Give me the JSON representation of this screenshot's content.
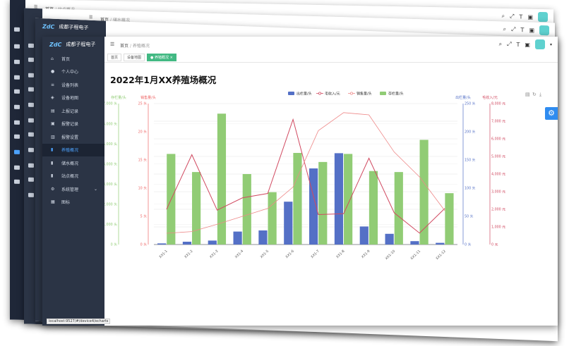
{
  "app": {
    "logo_mark": "ZdC",
    "logo_text": "成都子程电子"
  },
  "windows_behind": [
    {
      "breadcrumb_home": "首页",
      "breadcrumb_current": "站点概况"
    },
    {
      "breadcrumb_home": "首页",
      "breadcrumb_current": "储水概况"
    }
  ],
  "breadcrumb": {
    "home": "首页",
    "current": "养殖概况"
  },
  "tabs": [
    {
      "label": "首页"
    },
    {
      "label": "设备地图"
    },
    {
      "label": "养殖概况"
    }
  ],
  "sidebar": {
    "items": [
      {
        "label": "首页",
        "icon": "home-icon"
      },
      {
        "label": "个人中心",
        "icon": "user-icon"
      },
      {
        "label": "设备列表",
        "icon": "list-icon"
      },
      {
        "label": "设备地图",
        "icon": "map-icon"
      },
      {
        "label": "上报记录",
        "icon": "upload-icon"
      },
      {
        "label": "报警记录",
        "icon": "alarm-icon"
      },
      {
        "label": "报警设置",
        "icon": "settings-icon"
      },
      {
        "label": "养殖概况",
        "icon": "bar-chart-icon",
        "active": true
      },
      {
        "label": "储水概况",
        "icon": "bar-chart-icon"
      },
      {
        "label": "站点概况",
        "icon": "bar-chart-icon"
      },
      {
        "label": "系统管理",
        "icon": "gear-icon"
      },
      {
        "label": "图标",
        "icon": "icons-icon"
      }
    ]
  },
  "page_title": "2022年1月XX养殖场概况",
  "status_url": "localhost:9527/#/device4/echarts",
  "colors": {
    "sidebar": "#2b3445",
    "accent": "#4da3ff",
    "tab_active": "#42b983",
    "gear_button": "#2f8cf0"
  },
  "chart_data": {
    "type": "bar",
    "legend": [
      "出栏量/头",
      "毛收入/元",
      "销售量/头",
      "存栏量/头"
    ],
    "legend_position": "top-center",
    "categories": [
      "XX1-1",
      "XX1-2",
      "XX1-3",
      "XX1-4",
      "XX1-5",
      "XX1-6",
      "XX1-7",
      "XX1-8",
      "XX1-9",
      "XX1-10",
      "XX1-11",
      "XX1-12"
    ],
    "axes": [
      {
        "label": "存栏量/头",
        "position": "left-outer",
        "color": "#91cc75",
        "min": 0,
        "max": 7000,
        "ticks": [
          "0 头",
          "1,000 头",
          "2,000 头",
          "3,000 头",
          "4,000 头",
          "5,000 头",
          "6,000 头",
          "7,000 头"
        ]
      },
      {
        "label": "销售量/头",
        "position": "left-inner",
        "color": "#ee6666",
        "min": 0,
        "max": 25,
        "ticks": [
          "0 头",
          "5 头",
          "10 头",
          "15 头",
          "20 头",
          "25 头"
        ]
      },
      {
        "label": "出栏量/头",
        "position": "right-inner",
        "color": "#5470c6",
        "min": 0,
        "max": 250,
        "ticks": [
          "0 头",
          "50 头",
          "100 头",
          "150 头",
          "200 头",
          "250 头"
        ]
      },
      {
        "label": "毛收入/元",
        "position": "right-outer",
        "color": "#d14a61",
        "min": 0,
        "max": 8000,
        "ticks": [
          "0 元",
          "1,000 元",
          "2,000 元",
          "3,000 元",
          "4,000 元",
          "5,000 元",
          "6,000 元",
          "7,000 元",
          "8,000 元"
        ]
      }
    ],
    "series": [
      {
        "name": "出栏量/头",
        "type": "bar",
        "axis": 2,
        "color": "#5470c6",
        "values": [
          2,
          5,
          7,
          23,
          25,
          76,
          135,
          162,
          32,
          19,
          6,
          3
        ]
      },
      {
        "name": "存栏量/头",
        "type": "bar",
        "axis": 0,
        "color": "#91cc75",
        "values": [
          4500,
          3600,
          6500,
          3500,
          2600,
          4550,
          4100,
          4500,
          3650,
          3600,
          5200,
          2550
        ]
      },
      {
        "name": "毛收入/元",
        "type": "line",
        "axis": 3,
        "color": "#d14a61",
        "values": [
          2000,
          5100,
          1950,
          2650,
          2900,
          7100,
          1700,
          1750,
          4900,
          1800,
          650,
          2050
        ]
      },
      {
        "name": "销售量/头",
        "type": "line",
        "axis": 1,
        "color": "#ee8888",
        "values": [
          2,
          2.3,
          3.6,
          5,
          6.4,
          10.2,
          20.2,
          23.4,
          23,
          16.4,
          12,
          6
        ]
      }
    ],
    "grid": true
  }
}
